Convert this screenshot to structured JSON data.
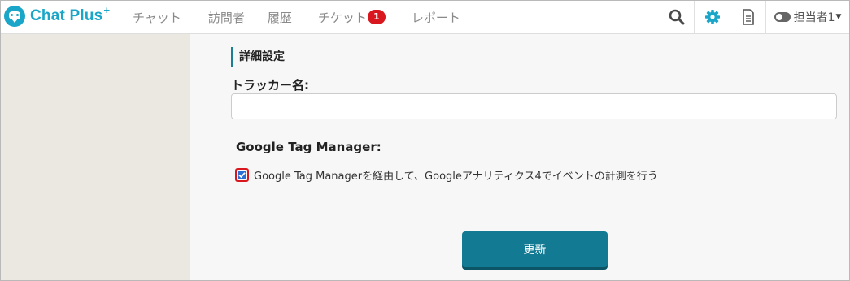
{
  "app": {
    "logo_text": "Chat Plus",
    "logo_plus": "+"
  },
  "nav": {
    "items": [
      {
        "label": "チャット"
      },
      {
        "label": "訪問者"
      },
      {
        "label": "履歴"
      },
      {
        "label": "チケット",
        "badge": "1"
      },
      {
        "label": "レポート"
      }
    ]
  },
  "tools": {
    "search_icon": "search-icon",
    "settings_icon": "gear-icon",
    "document_icon": "document-icon",
    "user_label": "担当者1",
    "accent_color": "#1aa6c8"
  },
  "form": {
    "section_title": "詳細設定",
    "tracker_label": "トラッカー名:",
    "tracker_value": "",
    "gtm_label": "Google Tag Manager:",
    "gtm_checkbox_label": "Google Tag Managerを経由して、Googleアナリティクス4でイベントの計測を行う",
    "gtm_checked": true,
    "submit_label": "更新",
    "submit_color": "#127b93"
  }
}
